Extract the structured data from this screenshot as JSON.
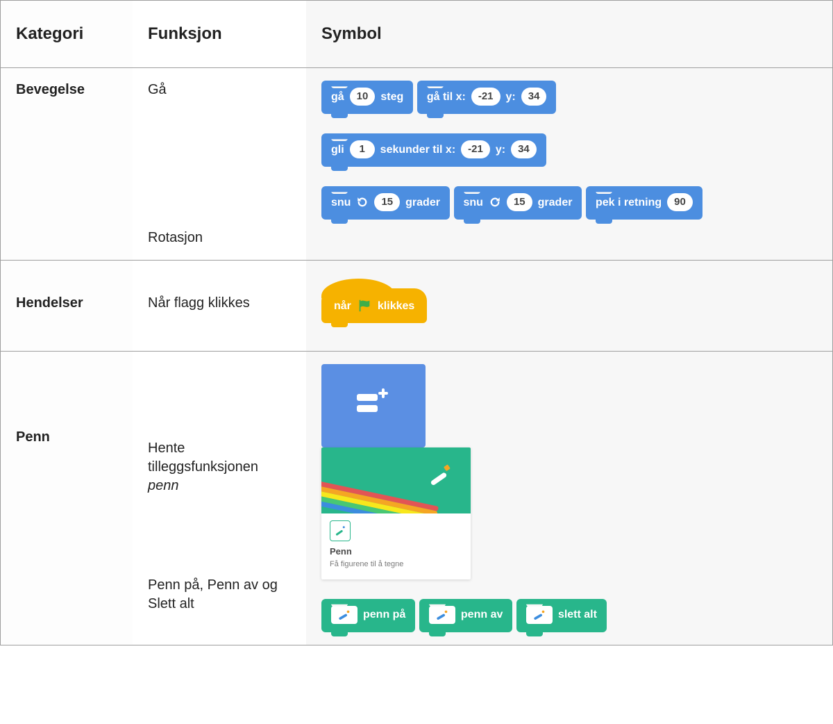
{
  "headers": {
    "category": "Kategori",
    "function": "Funksjon",
    "symbol": "Symbol"
  },
  "rows": {
    "movement": {
      "category": "Bevegelse",
      "go": {
        "label": "Gå",
        "block_go": {
          "lead": "gå",
          "value": "10",
          "trail": "steg"
        },
        "block_goto": {
          "lead": "gå til x:",
          "x": "-21",
          "mid": "y:",
          "y": "34"
        },
        "block_glide": {
          "lead": "gli",
          "sec": "1",
          "mid": "sekunder til x:",
          "x": "-21",
          "mid2": "y:",
          "y": "34"
        }
      },
      "rotation": {
        "label": "Rotasjon",
        "block_cw": {
          "lead": "snu",
          "value": "15",
          "trail": "grader"
        },
        "block_ccw": {
          "lead": "snu",
          "value": "15",
          "trail": "grader"
        },
        "block_point": {
          "lead": "pek i retning",
          "value": "90"
        }
      }
    },
    "events": {
      "category": "Hendelser",
      "flag": {
        "label": "Når flagg klikkes",
        "block": {
          "lead": "når",
          "trail": "klikkes"
        }
      }
    },
    "pen": {
      "category": "Penn",
      "fetch": {
        "label_l1": "Hente",
        "label_l2": "tilleggsfunksjonen",
        "label_l3": "penn",
        "card": {
          "title": "Penn",
          "subtitle": "Få figurene til å tegne"
        }
      },
      "ops": {
        "label": "Penn på, Penn av og Slett alt",
        "on": "penn på",
        "off": "penn av",
        "erase": "slett alt"
      }
    }
  }
}
